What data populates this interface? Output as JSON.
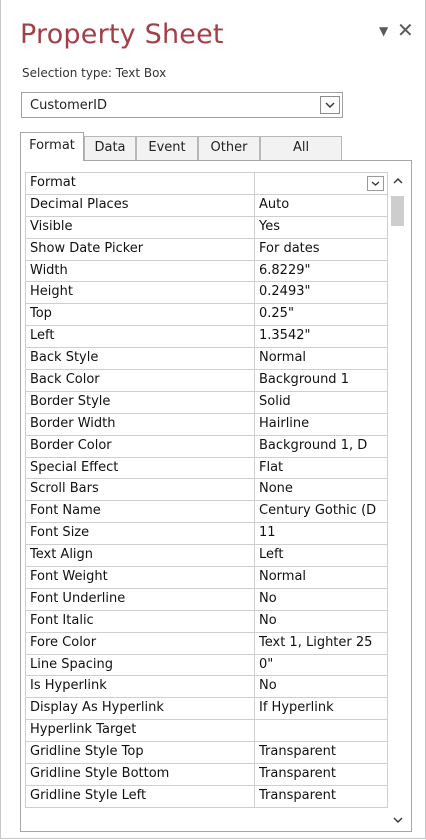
{
  "header": {
    "title": "Property Sheet",
    "selection_type": "Selection type:  Text Box"
  },
  "selector": {
    "value": "CustomerID"
  },
  "tabs": [
    {
      "label": "Format",
      "active": true
    },
    {
      "label": "Data",
      "active": false
    },
    {
      "label": "Event",
      "active": false
    },
    {
      "label": "Other",
      "active": false
    },
    {
      "label": "All",
      "active": false
    }
  ],
  "properties": [
    {
      "name": "Format",
      "value": ""
    },
    {
      "name": "Decimal Places",
      "value": "Auto"
    },
    {
      "name": "Visible",
      "value": "Yes"
    },
    {
      "name": "Show Date Picker",
      "value": "For dates"
    },
    {
      "name": "Width",
      "value": "6.8229\""
    },
    {
      "name": "Height",
      "value": "0.2493\""
    },
    {
      "name": "Top",
      "value": "0.25\""
    },
    {
      "name": "Left",
      "value": "1.3542\""
    },
    {
      "name": "Back Style",
      "value": "Normal"
    },
    {
      "name": "Back Color",
      "value": "Background 1"
    },
    {
      "name": "Border Style",
      "value": "Solid"
    },
    {
      "name": "Border Width",
      "value": "Hairline"
    },
    {
      "name": "Border Color",
      "value": "Background 1, D"
    },
    {
      "name": "Special Effect",
      "value": "Flat"
    },
    {
      "name": "Scroll Bars",
      "value": "None"
    },
    {
      "name": "Font Name",
      "value": "Century Gothic (D"
    },
    {
      "name": "Font Size",
      "value": "11"
    },
    {
      "name": "Text Align",
      "value": "Left"
    },
    {
      "name": "Font Weight",
      "value": "Normal"
    },
    {
      "name": "Font Underline",
      "value": "No"
    },
    {
      "name": "Font Italic",
      "value": "No"
    },
    {
      "name": "Fore Color",
      "value": "Text 1, Lighter 25"
    },
    {
      "name": "Line Spacing",
      "value": "0\""
    },
    {
      "name": "Is Hyperlink",
      "value": "No"
    },
    {
      "name": "Display As Hyperlink",
      "value": "If Hyperlink"
    },
    {
      "name": "Hyperlink Target",
      "value": ""
    },
    {
      "name": "Gridline Style Top",
      "value": "Transparent"
    },
    {
      "name": "Gridline Style Bottom",
      "value": "Transparent"
    },
    {
      "name": "Gridline Style Left",
      "value": "Transparent"
    }
  ],
  "colors": {
    "title": "#a33f46",
    "grid_line": "#cfcfcf"
  },
  "icons": {
    "pane_options": "triangle-down-icon",
    "close": "close-icon",
    "dropdown": "chevron-down-icon",
    "scroll_up": "chevron-up-icon",
    "scroll_down": "chevron-down-icon"
  }
}
